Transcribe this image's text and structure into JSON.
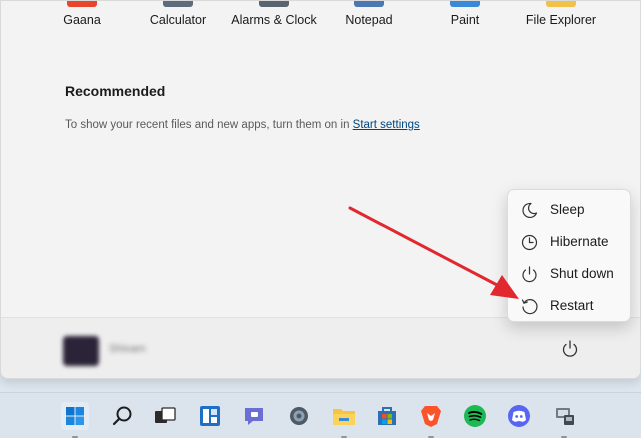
{
  "pinned_apps": [
    {
      "label": "Gaana",
      "icon": "gaana-icon",
      "color": "#e8452c"
    },
    {
      "label": "Calculator",
      "icon": "calculator-icon",
      "color": "#5d6b7a"
    },
    {
      "label": "Alarms & Clock",
      "icon": "alarms-clock-icon",
      "color": "#5a6470"
    },
    {
      "label": "Notepad",
      "icon": "notepad-icon",
      "color": "#4d77b3"
    },
    {
      "label": "Paint",
      "icon": "paint-icon",
      "color": "#3a88d8"
    },
    {
      "label": "File Explorer",
      "icon": "file-explorer-icon",
      "color": "#f0c24a"
    }
  ],
  "recommended": {
    "title": "Recommended",
    "message": "To show your recent files and new apps, turn them on in ",
    "link_text": "Start settings"
  },
  "user": {
    "name": "Shivam",
    "avatar": "user-avatar"
  },
  "power_menu": {
    "items": [
      {
        "label": "Sleep",
        "icon": "sleep-icon"
      },
      {
        "label": "Hibernate",
        "icon": "hibernate-icon"
      },
      {
        "label": "Shut down",
        "icon": "shut-down-icon"
      },
      {
        "label": "Restart",
        "icon": "restart-icon"
      }
    ]
  },
  "annotation": {
    "color": "#e0282e"
  },
  "taskbar": {
    "items": [
      {
        "icon": "windows-start-icon",
        "active": true
      },
      {
        "icon": "search-icon",
        "active": false
      },
      {
        "icon": "task-view-icon",
        "active": false
      },
      {
        "icon": "widgets-icon",
        "active": false
      },
      {
        "icon": "teams-chat-icon",
        "active": false
      },
      {
        "icon": "settings-gear-icon",
        "active": false
      },
      {
        "icon": "file-explorer-icon",
        "active": true
      },
      {
        "icon": "microsoft-store-icon",
        "active": false
      },
      {
        "icon": "brave-browser-icon",
        "active": true
      },
      {
        "icon": "spotify-icon",
        "active": false
      },
      {
        "icon": "discord-icon",
        "active": false
      },
      {
        "icon": "remote-desktop-icon",
        "active": true
      }
    ]
  }
}
